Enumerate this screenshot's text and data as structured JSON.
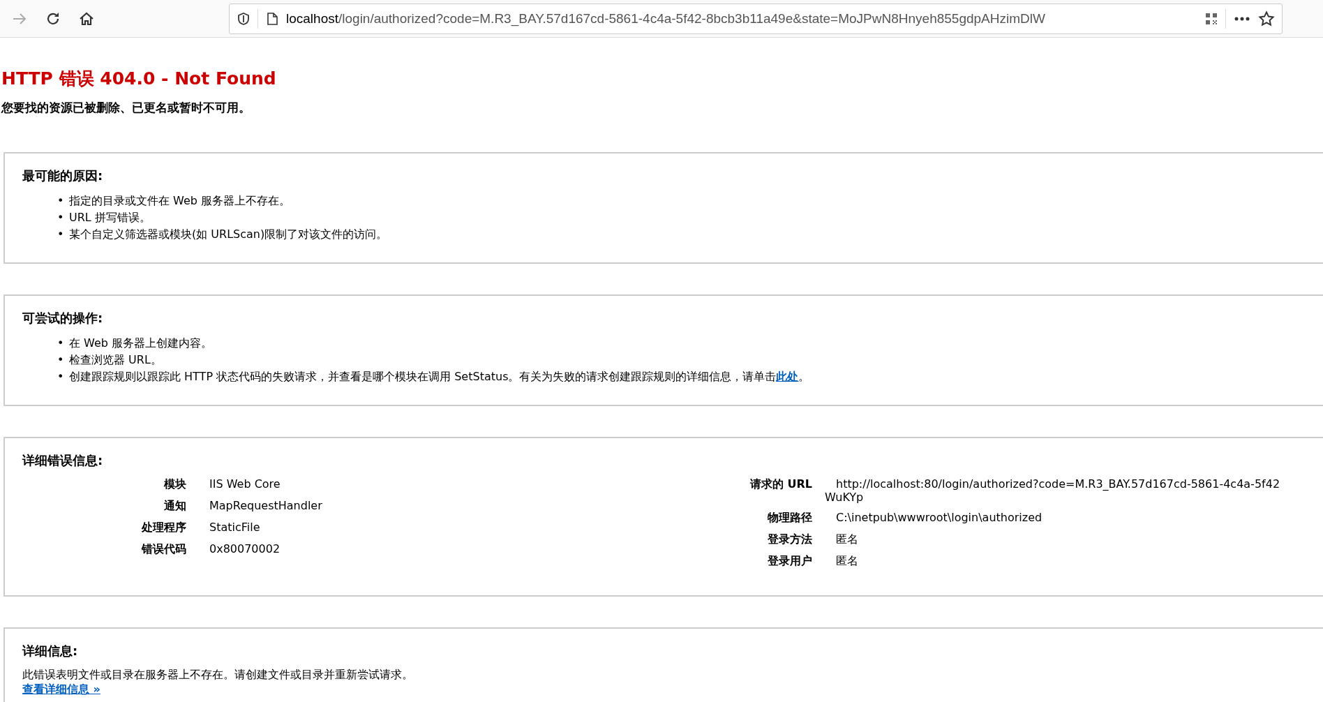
{
  "toolbar": {
    "url_host": "localhost",
    "url_path": "/login/authorized?code=M.R3_BAY.57d167cd-5861-4c4a-5f42-8bcb3b11a49e&state=MoJPwN8Hnyeh855gdpAHzimDlW",
    "forward_disabled": true
  },
  "error": {
    "title": "HTTP 错误 404.0 - Not Found",
    "subtitle": "您要找的资源已被删除、已更名或暂时不可用。"
  },
  "bullet": "•",
  "sections": [
    {
      "kind": "list",
      "heading": "最可能的原因:",
      "items": [
        "指定的目录或文件在 Web 服务器上不存在。",
        "URL 拼写错误。",
        "某个自定义筛选器或模块(如 URLScan)限制了对该文件的访问。"
      ]
    },
    {
      "kind": "list",
      "heading": "可尝试的操作:",
      "items": [
        "在 Web 服务器上创建内容。",
        "检查浏览器 URL。",
        "创建跟踪规则以跟踪此 HTTP 状态代码的失败请求，并查看是哪个模块在调用 SetStatus。有关为失败的请求创建跟踪规则的详细信息，请单击"
      ],
      "link": "此处",
      "link_after": "。"
    },
    {
      "kind": "details",
      "heading": "详细错误信息:",
      "left": [
        {
          "label": "模块",
          "value": [
            "IIS Web Core"
          ]
        },
        {
          "label": "通知",
          "value": [
            "MapRequestHandler"
          ]
        },
        {
          "label": "处理程序",
          "value": [
            "StaticFile"
          ]
        },
        {
          "label": "错误代码",
          "value": [
            "0x80070002"
          ]
        }
      ],
      "right": [
        {
          "label": "请求的 URL",
          "value": [
            "http://localhost:80/login/authorized?code=M.R3_BAY.57d167cd-5861-4c4a-5f42",
            "WuKYp"
          ]
        },
        {
          "label": "物理路径",
          "value": [
            "C:\\inetpub\\wwwroot\\login\\authorized"
          ]
        },
        {
          "label": "登录方法",
          "value": [
            "匿名"
          ]
        },
        {
          "label": "登录用户",
          "value": [
            "匿名"
          ]
        }
      ]
    },
    {
      "kind": "info",
      "heading": "详细信息:",
      "text": "此错误表明文件或目录在服务器上不存在。请创建文件或目录并重新尝试请求。",
      "link": "查看详细信息 »"
    }
  ]
}
